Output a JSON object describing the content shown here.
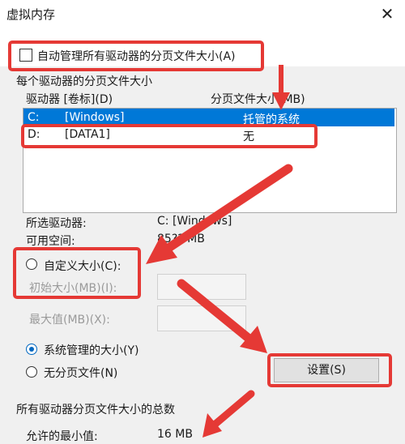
{
  "window": {
    "title": "虚拟内存"
  },
  "auto_manage": {
    "label": "自动管理所有驱动器的分页文件大小(A)",
    "checked": false
  },
  "per_drive_group": {
    "title": "每个驱动器的分页文件大小"
  },
  "drive_table": {
    "columns": [
      "驱动器 [卷标](D)",
      "分页文件大小(MB)"
    ],
    "rows": [
      {
        "drive": "C:",
        "label": "[Windows]",
        "size": "托管的系统",
        "selected": true
      },
      {
        "drive": "D:",
        "label": "[DATA1]",
        "size": "无",
        "selected": false
      }
    ]
  },
  "selected_drive": {
    "label": "所选驱动器:",
    "value": "C:  [Windows]"
  },
  "free_space": {
    "label": "可用空间:",
    "value": "85?? MB"
  },
  "custom_size": {
    "label": "自定义大小(C):"
  },
  "initial_size": {
    "label": "初始大小(MB)(I):"
  },
  "max_size": {
    "label": "最大值(MB)(X):"
  },
  "system_managed": {
    "label": "系统管理的大小(Y)",
    "checked": true
  },
  "no_paging": {
    "label": "无分页文件(N)"
  },
  "set_button": {
    "label": "设置(S)"
  },
  "total_group": {
    "title": "所有驱动器分页文件大小的总数"
  },
  "min_allowed": {
    "label": "允许的最小值:",
    "value": "16 MB"
  },
  "colors": {
    "accent": "#0078d7",
    "highlight": "#e53935"
  }
}
